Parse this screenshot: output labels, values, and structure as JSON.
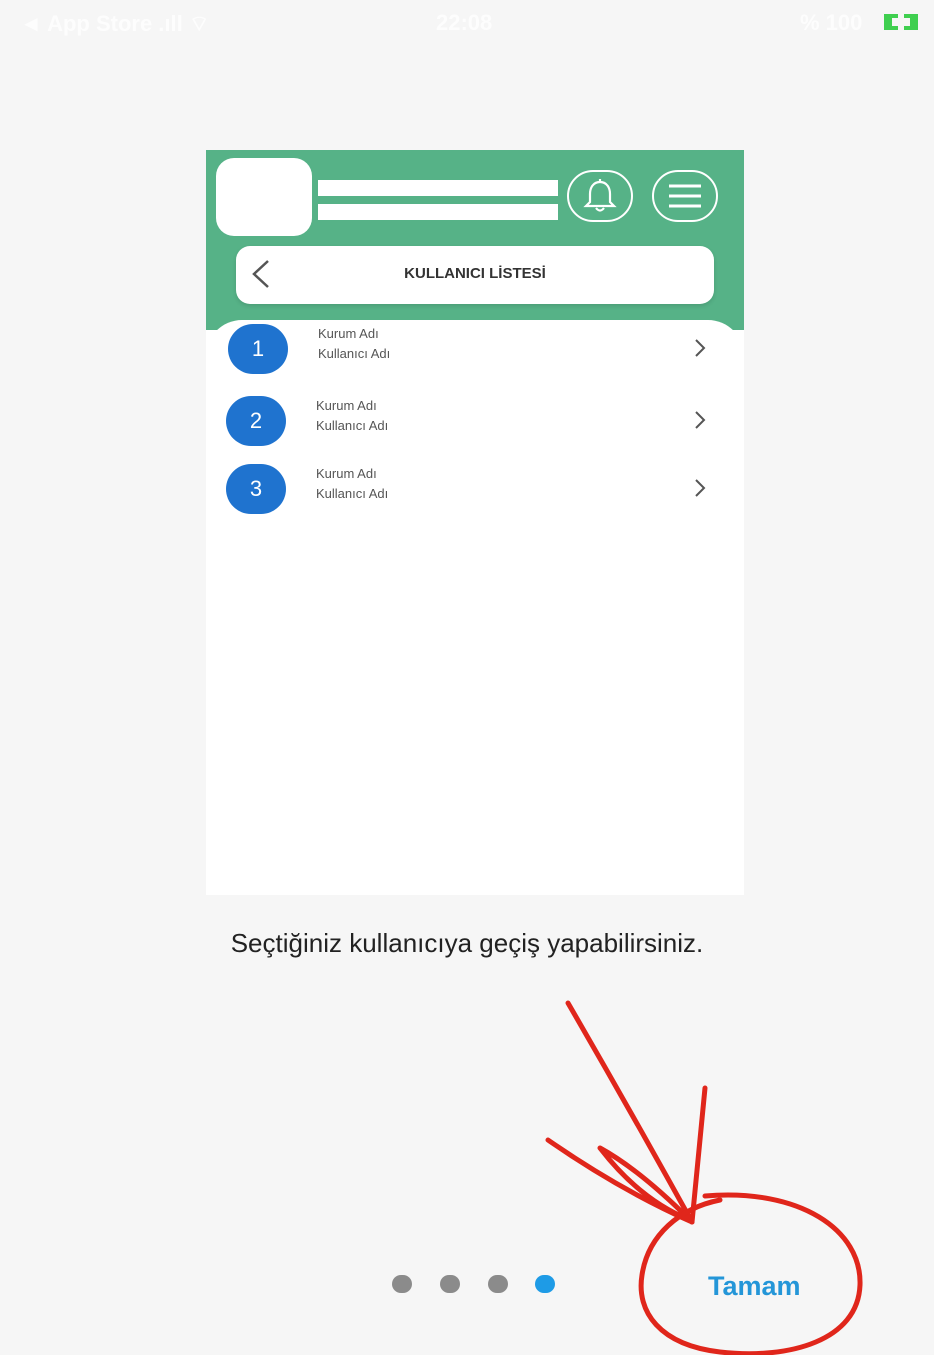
{
  "status_bar": {
    "left": "◄ App Store .ıll ⌔",
    "center": "22:08",
    "right": "% 100"
  },
  "preview": {
    "title": "KULLANICI LİSTESİ",
    "items": [
      {
        "number": "1",
        "line1": "Kurum Adı",
        "line2": "Kullanıcı Adı"
      },
      {
        "number": "2",
        "line1": "Kurum Adı",
        "line2": "Kullanıcı Adı"
      },
      {
        "number": "3",
        "line1": "Kurum Adı",
        "line2": "Kullanıcı Adı"
      }
    ]
  },
  "caption": "Seçtiğiniz kullanıcıya geçiş yapabilirsiniz.",
  "pagination": {
    "total": 4,
    "active_index": 3
  },
  "done_button": "Tamam",
  "colors": {
    "header_green": "#56b287",
    "number_blue": "#1f73cf",
    "button_blue": "#2496d8",
    "dot_active": "#1e9be6",
    "dot_inactive": "#8b8b8b",
    "annotation_red": "#e0261b"
  }
}
